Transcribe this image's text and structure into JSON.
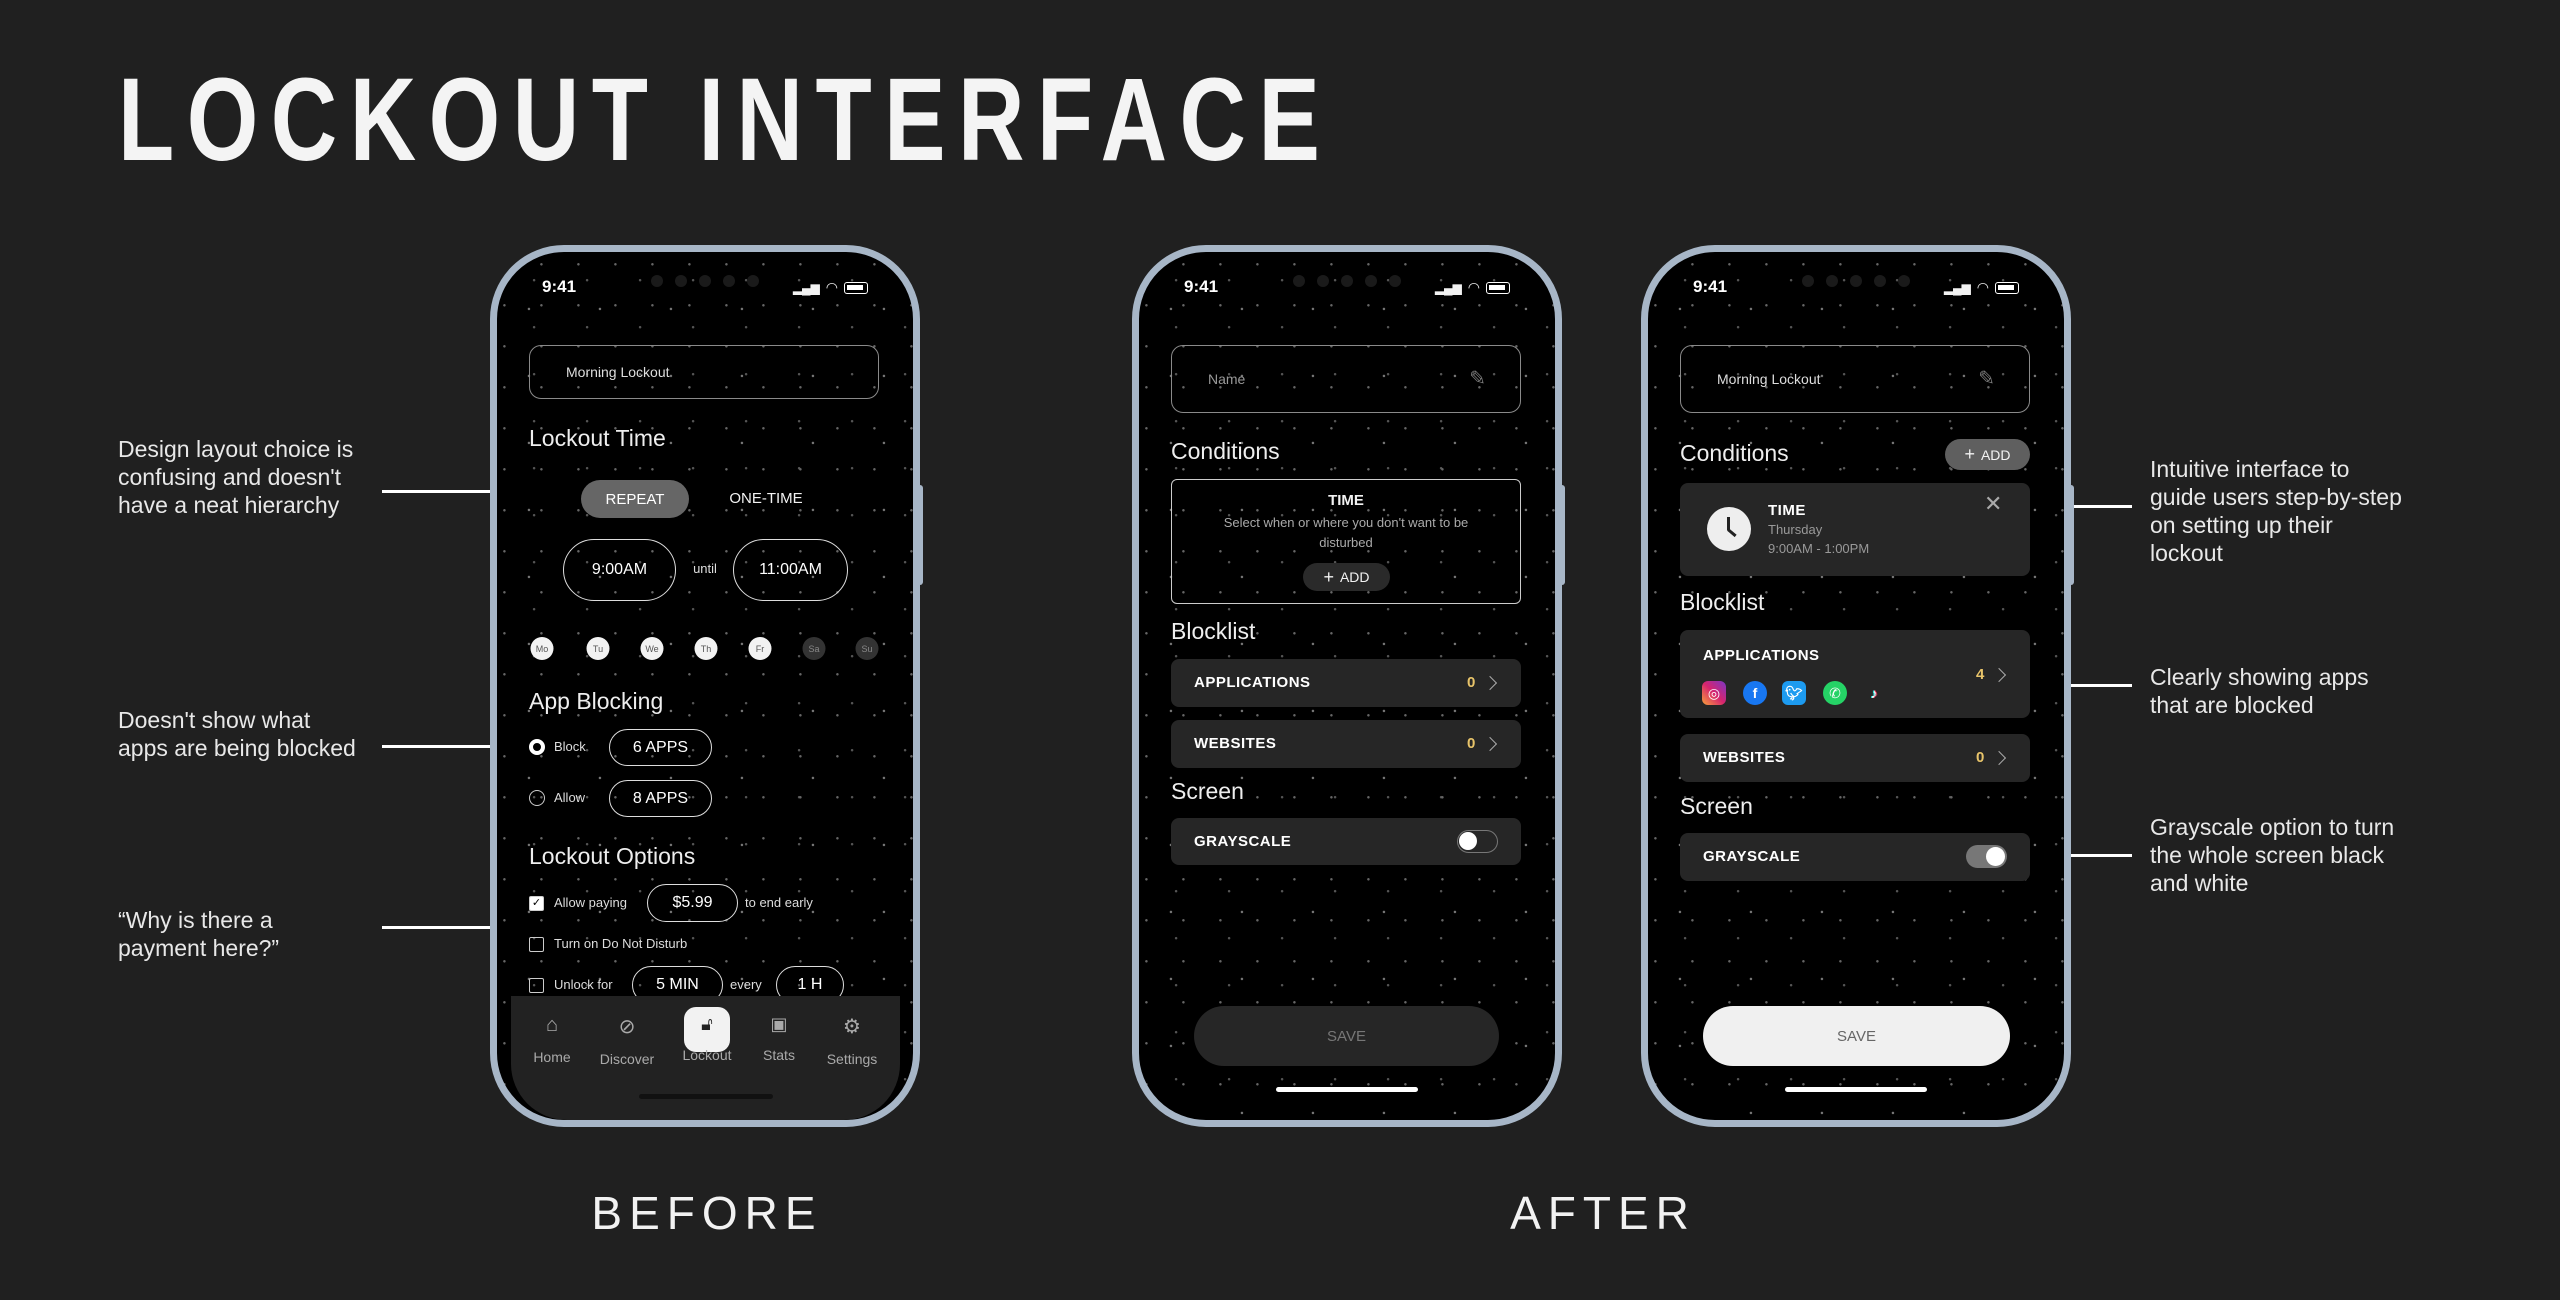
{
  "title": "LOCKOUT INTERFACE",
  "captions": {
    "before": "BEFORE",
    "after": "AFTER"
  },
  "notes_left": [
    "Design layout choice is confusing and doesn't have a neat hierarchy",
    "Doesn't show what apps are being blocked",
    "“Why is there a payment here?”"
  ],
  "notes_right": [
    "Intuitive interface to guide users step-by-step on setting up their lockout",
    "Clearly showing apps that are blocked",
    "Grayscale option to turn the whole screen black and white"
  ],
  "status_time": "9:41",
  "before": {
    "name": "Morning Lockout",
    "lockout_time": "Lockout Time",
    "modes": [
      "REPEAT",
      "ONE-TIME"
    ],
    "start": "9:00AM",
    "until": "until",
    "end": "11:00AM",
    "days": [
      {
        "label": "Mo",
        "on": true
      },
      {
        "label": "Tu",
        "on": true
      },
      {
        "label": "We",
        "on": true
      },
      {
        "label": "Th",
        "on": true
      },
      {
        "label": "Fr",
        "on": true
      },
      {
        "label": "Sa",
        "on": false
      },
      {
        "label": "Su",
        "on": false
      }
    ],
    "app_blocking": "App Blocking",
    "block": "Block",
    "block_apps": "6 APPS",
    "allow": "Allow",
    "allow_apps": "8 APPS",
    "lockout_options": "Lockout Options",
    "allow_paying": "Allow paying",
    "price": "$5.99",
    "end_early": "to end early",
    "dnd": "Turn on Do Not Disturb",
    "unlock_for": "Unlock for",
    "unlock_dur": "5 MIN",
    "every": "every",
    "unlock_every": "1 H",
    "tabs": [
      "Home",
      "Discover",
      "Lockout",
      "Stats",
      "Settings"
    ]
  },
  "after_empty": {
    "name_placeholder": "Name",
    "conditions": "Conditions",
    "time_title": "TIME",
    "time_desc": "Select when or where you don't want to be disturbed",
    "add": "ADD",
    "blocklist": "Blocklist",
    "applications": "APPLICATIONS",
    "applications_count": "0",
    "websites": "WEBSITES",
    "websites_count": "0",
    "screen": "Screen",
    "grayscale": "GRAYSCALE",
    "grayscale_on": false,
    "save": "SAVE"
  },
  "after_filled": {
    "name": "Morning Lockout",
    "conditions": "Conditions",
    "add": "ADD",
    "time_title": "TIME",
    "time_day": "Thursday",
    "time_range": "9:00AM - 1:00PM",
    "blocklist": "Blocklist",
    "applications": "APPLICATIONS",
    "applications_count": "4",
    "apps": [
      "instagram",
      "facebook",
      "twitter",
      "whatsapp",
      "tiktok"
    ],
    "websites": "WEBSITES",
    "websites_count": "0",
    "screen": "Screen",
    "grayscale": "GRAYSCALE",
    "grayscale_on": true,
    "save": "SAVE"
  },
  "colors": {
    "background": "#202020",
    "bezel": "#a7b6c7",
    "count_accent": "#e8c46a",
    "card": "#262626"
  }
}
